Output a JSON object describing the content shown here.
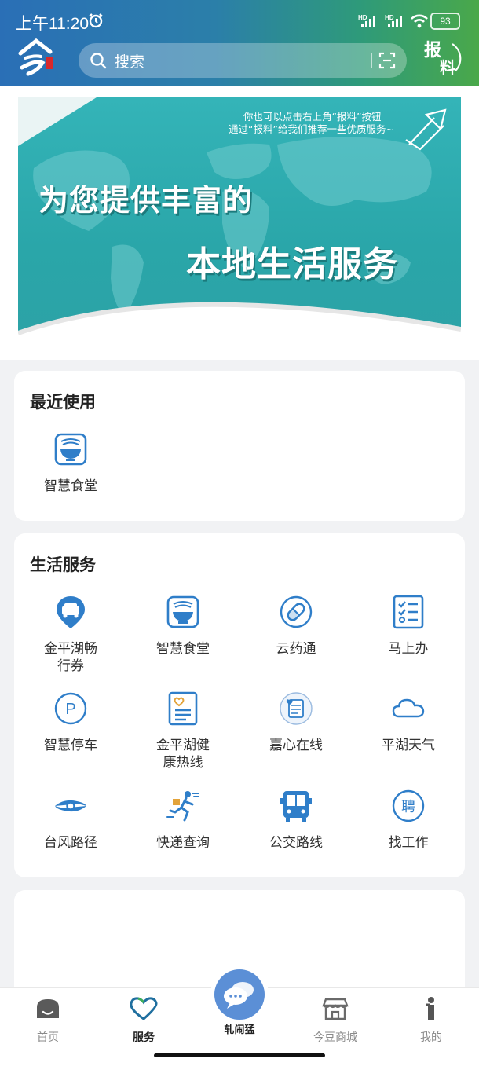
{
  "status_bar": {
    "time": "上午11:20",
    "battery": "93"
  },
  "header": {
    "search_placeholder": "搜索",
    "report_line1": "报",
    "report_line2": "料"
  },
  "banner": {
    "tip_line1": "你也可以点击右上角“报料”按钮",
    "tip_line2": "通过“报料”给我们推荐一些优质服务~",
    "headline1": "为您提供丰富的",
    "headline2": "本地生活服务"
  },
  "recent": {
    "title": "最近使用",
    "items": [
      {
        "label": "智慧食堂",
        "icon": "bowl-icon"
      }
    ]
  },
  "life": {
    "title": "生活服务",
    "items": [
      {
        "label": "金平湖畅行券",
        "line1": "金平湖畅",
        "line2": "行券",
        "icon": "car-location-icon"
      },
      {
        "label": "智慧食堂",
        "icon": "bowl-icon"
      },
      {
        "label": "云药通",
        "icon": "pill-icon"
      },
      {
        "label": "马上办",
        "icon": "checklist-icon"
      },
      {
        "label": "智慧停车",
        "icon": "parking-icon"
      },
      {
        "label": "金平湖健康热线",
        "line1": "金平湖健",
        "line2": "康热线",
        "icon": "health-doc-icon"
      },
      {
        "label": "嘉心在线",
        "icon": "heart-note-icon"
      },
      {
        "label": "平湖天气",
        "icon": "cloud-icon"
      },
      {
        "label": "台风路径",
        "icon": "typhoon-icon"
      },
      {
        "label": "快递查询",
        "icon": "courier-icon"
      },
      {
        "label": "公交路线",
        "icon": "bus-icon"
      },
      {
        "label": "找工作",
        "icon": "recruit-icon"
      }
    ]
  },
  "tabbar": {
    "tabs": [
      {
        "label": "首页",
        "icon": "home-icon"
      },
      {
        "label": "服务",
        "icon": "heart-icon"
      },
      {
        "label": "轧闹猛",
        "icon": "chat-bubble-icon"
      },
      {
        "label": "今豆商城",
        "icon": "store-icon"
      },
      {
        "label": "我的",
        "icon": "person-icon"
      }
    ],
    "active": "服务"
  },
  "colors": {
    "accent": "#2f7ec9",
    "header_start": "#2a6fb6",
    "header_end": "#4aa84a",
    "banner": "#2ca8ab"
  }
}
